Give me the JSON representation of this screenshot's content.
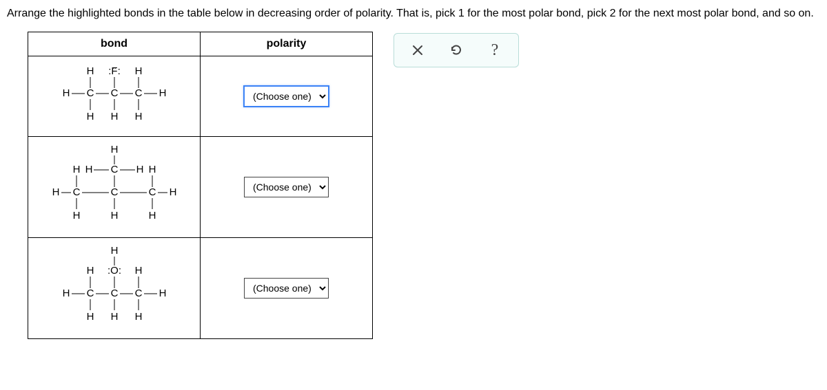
{
  "instructions": "Arrange the highlighted bonds in the table below in decreasing order of polarity. That is, pick 1 for the most polar bond, pick 2 for the next most polar bond, and so on.",
  "headers": {
    "bond": "bond",
    "polarity": "polarity"
  },
  "choose_label": "(Choose one)",
  "rows": [
    {
      "structure": "2-fluoropropane (C–F highlighted)",
      "atoms": {
        "top": [
          "H",
          ":F:",
          "H"
        ],
        "mid": [
          "H",
          "C",
          "C",
          "C",
          "H"
        ],
        "bot": [
          "H",
          "H",
          "H"
        ]
      }
    },
    {
      "structure": "2-methylpropane (C–C highlighted)",
      "atoms": {
        "branch_top": "H",
        "mid_upper": [
          "H",
          "H",
          "C",
          "H",
          "H"
        ],
        "mid_lower": [
          "H",
          "C",
          "C",
          "C",
          "H"
        ],
        "bot": [
          "H",
          "H",
          "H"
        ]
      }
    },
    {
      "structure": "2-propanol (C–O highlighted)",
      "atoms": {
        "branch_top": "H",
        "top": [
          "H",
          ":O:",
          "H"
        ],
        "mid": [
          "H",
          "C",
          "C",
          "C",
          "H"
        ],
        "bot": [
          "H",
          "H",
          "H"
        ]
      }
    }
  ],
  "chart_data": {
    "type": "table",
    "title": "Bond polarity ranking",
    "columns": [
      "bond",
      "polarity"
    ],
    "rows": [
      {
        "bond": "C–F (in CH3CHFCH3)",
        "polarity": "(Choose one)"
      },
      {
        "bond": "C–C (in isobutane)",
        "polarity": "(Choose one)"
      },
      {
        "bond": "C–O (in isopropanol)",
        "polarity": "(Choose one)"
      }
    ]
  }
}
